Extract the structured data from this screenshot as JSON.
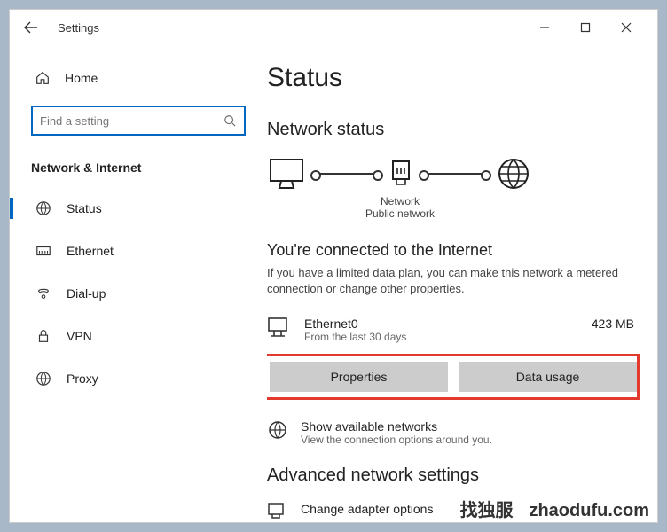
{
  "titlebar": {
    "title": "Settings"
  },
  "sidebar": {
    "home_label": "Home",
    "search_placeholder": "Find a setting",
    "category_header": "Network & Internet",
    "items": [
      {
        "label": "Status",
        "icon": "status-icon",
        "active": true
      },
      {
        "label": "Ethernet",
        "icon": "ethernet-icon",
        "active": false
      },
      {
        "label": "Dial-up",
        "icon": "dialup-icon",
        "active": false
      },
      {
        "label": "VPN",
        "icon": "vpn-icon",
        "active": false
      },
      {
        "label": "Proxy",
        "icon": "proxy-icon",
        "active": false
      }
    ]
  },
  "main": {
    "page_title": "Status",
    "network_status_heading": "Network status",
    "diagram": {
      "caption_line1": "Network",
      "caption_line2": "Public network"
    },
    "connected_heading": "You're connected to the Internet",
    "connected_desc": "If you have a limited data plan, you can make this network a metered connection or change other properties.",
    "adapter": {
      "name": "Ethernet0",
      "sub": "From the last 30 days",
      "usage": "423 MB"
    },
    "properties_btn": "Properties",
    "data_usage_btn": "Data usage",
    "show_networks": {
      "title": "Show available networks",
      "sub": "View the connection options around you."
    },
    "advanced_heading": "Advanced network settings",
    "change_adapter_label": "Change adapter options"
  },
  "watermark": {
    "cn": "找独服",
    "url": "zhaodufu.com"
  }
}
